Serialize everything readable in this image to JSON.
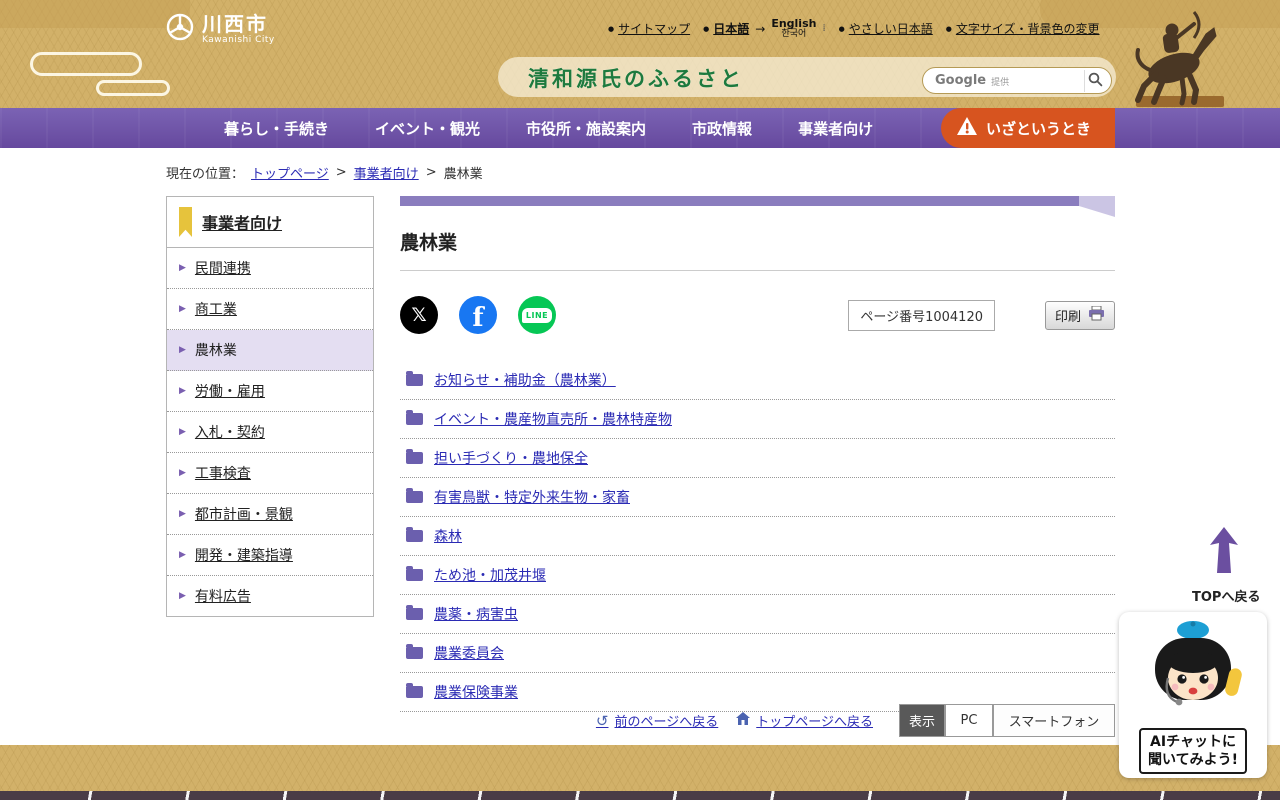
{
  "header": {
    "city_name": "川西市",
    "city_name_en": "Kawanishi City",
    "utility": {
      "sitemap": "サイトマップ",
      "japanese": "日本語",
      "english": "English",
      "korean": "한국어",
      "easy_japanese": "やさしい日本語",
      "text_size": "文字サイズ・背景色の変更"
    },
    "tagline": "清和源氏のふるさと",
    "search": {
      "brand": "Google",
      "provided_label": "提供"
    }
  },
  "nav": {
    "items": [
      {
        "label": "暮らし・手続き"
      },
      {
        "label": "イベント・観光"
      },
      {
        "label": "市役所・施設案内"
      },
      {
        "label": "市政情報"
      },
      {
        "label": "事業者向け"
      }
    ],
    "emergency": "いざというとき"
  },
  "breadcrumb": {
    "prefix": "現在の位置：",
    "home": "トップページ",
    "section": "事業者向け",
    "current": "農林業",
    "separator": ">"
  },
  "sidebar": {
    "title": "事業者向け",
    "items": [
      {
        "label": "民間連携"
      },
      {
        "label": "商工業"
      },
      {
        "label": "農林業"
      },
      {
        "label": "労働・雇用"
      },
      {
        "label": "入札・契約"
      },
      {
        "label": "工事検査"
      },
      {
        "label": "都市計画・景観"
      },
      {
        "label": "開発・建築指導"
      },
      {
        "label": "有料広告"
      }
    ]
  },
  "main": {
    "title": "農林業",
    "page_number": "ページ番号1004120",
    "print_label": "印刷",
    "social": {
      "x": "𝕏",
      "facebook": "f",
      "line": "LINE"
    },
    "categories": [
      {
        "label": "お知らせ・補助金（農林業）"
      },
      {
        "label": "イベント・農産物直売所・農林特産物"
      },
      {
        "label": "担い手づくり・農地保全"
      },
      {
        "label": "有害鳥獣・特定外来生物・家畜"
      },
      {
        "label": "森林"
      },
      {
        "label": "ため池・加茂井堰"
      },
      {
        "label": "農薬・病害虫"
      },
      {
        "label": "農業委員会"
      },
      {
        "label": "農業保険事業"
      }
    ]
  },
  "page_bottom": {
    "back_link": "前のページへ戻る",
    "top_link": "トップページへ戻る",
    "display_button": "表示",
    "pc_button": "PC",
    "smartphone_button": "スマートフォン"
  },
  "floating": {
    "back_to_top": "TOPへ戻る",
    "ai_chat_line1": "AIチャットに",
    "ai_chat_line2": "聞いてみよう!"
  },
  "colors": {
    "header_gold": "#d2b169",
    "nav_purple": "#6e56a8",
    "emergency_orange": "#d7541f",
    "link_blue": "#2b2bb4",
    "accent_purple": "#8a7dbe",
    "highlight_purple": "#e4def2",
    "tagline_green": "#1d7a3e"
  }
}
